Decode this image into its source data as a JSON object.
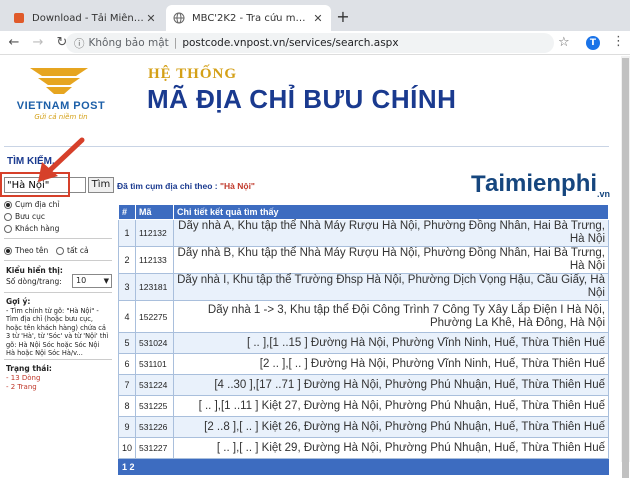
{
  "browser": {
    "tabs": [
      {
        "title": "Download - Tải Miễn Phí VN - Ph",
        "active": false
      },
      {
        "title": "MBC'2K2 - Tra cứu mã bưu chính",
        "active": true
      }
    ],
    "new_tab": "+",
    "omnibox": {
      "security": "Không bảo mật",
      "url": "postcode.vnpost.vn/services/search.aspx"
    },
    "profile_initial": "T"
  },
  "header": {
    "brand": "VIETNAM POST",
    "slogan": "Gửi cả niềm tin",
    "system": "HỆ THỐNG",
    "title": "MÃ ĐỊA CHỈ BƯU CHÍNH"
  },
  "search": {
    "section_title": "TÌM KIẾM",
    "input_value": "\"Hà Nội\"",
    "button_label": "Tìm",
    "result_prefix": "Đã tìm cụm địa chỉ theo :",
    "result_query": "\"Hà Nội\""
  },
  "watermark": {
    "text": "aimienphi",
    "suffix": ".vn"
  },
  "left_panel": {
    "mode_options": [
      {
        "label": "Cụm địa chỉ",
        "selected": true
      },
      {
        "label": "Bưu cục",
        "selected": false
      },
      {
        "label": "Khách hàng",
        "selected": false
      }
    ],
    "scope_options": [
      {
        "label": "Theo tên",
        "selected": true
      },
      {
        "label": "tất cả",
        "selected": false
      }
    ],
    "display_title": "Kiểu hiển thị:",
    "rows_label": "Số dòng/trang:",
    "rows_value": "10",
    "hint_title": "Gợi ý:",
    "hint_text": "- Tìm chính từ gõ: \"Hà Nội\" - Tìm địa chỉ (hoặc bưu cục, hoặc tên khách hàng) chứa cả 3 từ 'Hà', từ 'Sóc' và từ 'Nội' thì gõ: Hà Nội Sóc hoặc Sóc Nội Hà hoặc Nội Sóc Hà/v...",
    "status_title": "Trạng thái:",
    "status_lines": [
      "- 13 Dòng",
      "- 2 Trang"
    ]
  },
  "table": {
    "headers": [
      "#",
      "Mã",
      "Chi tiết kết quả tìm thấy"
    ],
    "rows": [
      {
        "num": "1",
        "code": "112132",
        "address": "Dãy nhà A, Khu tập thể Nhà Máy Rượu Hà Nội, Phường Đồng Nhân, Hai Bà Trưng, Hà Nội"
      },
      {
        "num": "2",
        "code": "112133",
        "address": "Dãy nhà B, Khu tập thể Nhà Máy Rượu Hà Nội, Phường Đồng Nhân, Hai Bà Trưng, Hà Nội"
      },
      {
        "num": "3",
        "code": "123181",
        "address": "Dãy nhà I, Khu tập thể Trường Đhsp Hà Nội, Phường Dịch Vọng Hậu, Cầu Giấy, Hà Nội"
      },
      {
        "num": "4",
        "code": "152275",
        "address": "Dãy nhà 1 -> 3, Khu tập thể Đội Công Trình 7 Công Ty Xây Lắp Điện I Hà Nội, Phường La Khê, Hà Đông, Hà Nội"
      },
      {
        "num": "5",
        "code": "531024",
        "address": "[ .. ],[1 ..15 ] Đường Hà Nội, Phường Vĩnh Ninh, Huế, Thừa Thiên Huế"
      },
      {
        "num": "6",
        "code": "531101",
        "address": "[2 .. ],[ .. ] Đường Hà Nội, Phường Vĩnh Ninh, Huế, Thừa Thiên Huế"
      },
      {
        "num": "7",
        "code": "531224",
        "address": "[4 ..30 ],[17 ..71 ] Đường Hà Nội, Phường Phú Nhuận, Huế, Thừa Thiên Huế"
      },
      {
        "num": "8",
        "code": "531225",
        "address": "[ .. ],[1 ..11 ] Kiệt 27, Đường Hà Nội, Phường Phú Nhuận, Huế, Thừa Thiên Huế"
      },
      {
        "num": "9",
        "code": "531226",
        "address": "[2 ..8 ],[ .. ] Kiệt 26, Đường Hà Nội, Phường Phú Nhuận, Huế, Thừa Thiên Huế"
      },
      {
        "num": "10",
        "code": "531227",
        "address": "[ .. ],[ .. ] Kiệt 29, Đường Hà Nội, Phường Phú Nhuận, Huế, Thừa Thiên Huế"
      }
    ],
    "pager": "1 2"
  }
}
